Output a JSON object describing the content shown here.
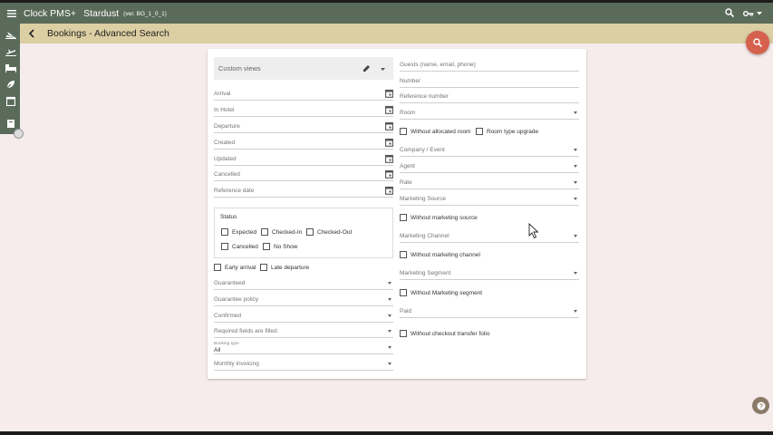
{
  "topbar": {
    "app_name": "Clock PMS+",
    "hotel_name": "Stardust",
    "version": "(ver. BG_1_0_1)"
  },
  "header": {
    "title": "Bookings - Advanced Search"
  },
  "custom_views": {
    "label": "Custom views"
  },
  "dates": {
    "arrival": "Arrival",
    "in_hotel": "In Hotel",
    "departure": "Departure",
    "created": "Created",
    "updated": "Updated",
    "cancelled": "Cancelled",
    "reference_date": "Reference date"
  },
  "status": {
    "title": "Status",
    "expected": "Expected",
    "checked_in": "Checked-In",
    "checked_out": "Checked-Out",
    "cancelled": "Cancelled",
    "no_show": "No Show"
  },
  "arrival_flags": {
    "early_arrival": "Early arrival",
    "late_departure": "Late departure"
  },
  "left_selects": {
    "guaranteed": "Guaranteed",
    "guarantee_policy": "Guarantee policy",
    "confirmed": "Confirmed",
    "required_fields": "Required fields are filled",
    "booking_type_label": "Booking type",
    "booking_type_value": "All",
    "monthly_invoicing": "Monthly invoicing"
  },
  "right": {
    "guests": "Guests (name, email, phone)",
    "number": "Number",
    "reference_number": "Reference number",
    "room": "Room",
    "without_allocated_room": "Without allocated room",
    "room_type_upgrade": "Room type upgrade",
    "company_event": "Company / Event",
    "agent": "Agent",
    "rate": "Rate",
    "marketing_source": "Marketing Source",
    "without_marketing_source": "Without marketing source",
    "marketing_channel": "Marketing Channel",
    "without_marketing_channel": "Without marketing channel",
    "marketing_segment": "Marketing Segment",
    "without_marketing_segment": "Without Marketing segment",
    "paid": "Paid",
    "without_checkout_transfer_folio": "Without checkout transfer folio"
  },
  "colors": {
    "topbar": "#5a6b5a",
    "subbar": "#dccfa3",
    "fab": "#d5614e",
    "background": "#f6ecec"
  }
}
